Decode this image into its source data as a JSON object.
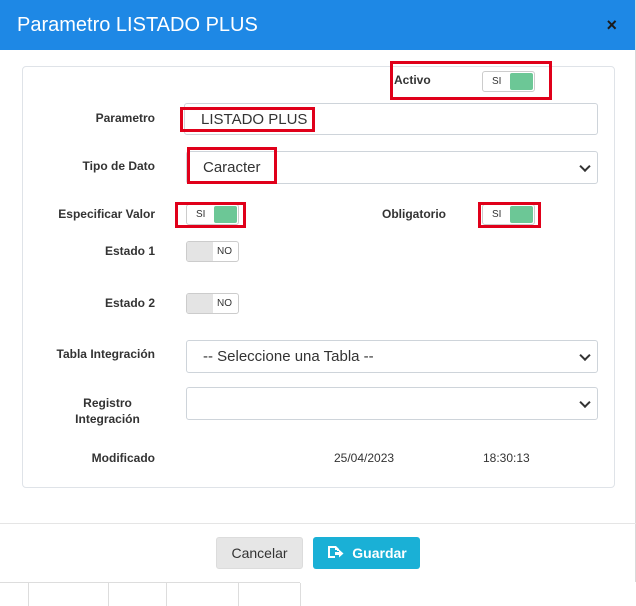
{
  "modal": {
    "title": "Parametro LISTADO PLUS",
    "close_glyph": "×"
  },
  "form": {
    "activo": {
      "label": "Activo",
      "state": "SI",
      "on": true
    },
    "parametro": {
      "label": "Parametro",
      "value": "LISTADO PLUS"
    },
    "tipo_dato": {
      "label": "Tipo de Dato",
      "value": "Caracter"
    },
    "especificar_valor": {
      "label": "Especificar Valor",
      "state": "SI",
      "on": true
    },
    "obligatorio": {
      "label": "Obligatorio",
      "state": "SI",
      "on": true
    },
    "estado1": {
      "label": "Estado 1",
      "state": "NO",
      "on": false
    },
    "estado2": {
      "label": "Estado 2",
      "state": "NO",
      "on": false
    },
    "tabla_integracion": {
      "label": "Tabla Integración",
      "value": "-- Seleccione una Tabla --"
    },
    "registro_integracion": {
      "label_line1": "Registro",
      "label_line2": "Integración",
      "value": ""
    },
    "modificado": {
      "label": "Modificado",
      "date": "25/04/2023",
      "time": "18:30:13"
    }
  },
  "footer": {
    "cancel_label": "Cancelar",
    "save_label": "Guardar"
  },
  "colors": {
    "header": "#1e88e5",
    "toggle_on": "#6cc796",
    "highlight": "#e0001a",
    "save_button": "#1ab0d6"
  },
  "icons": {
    "close": "close-icon",
    "save": "save-icon",
    "select_arrow": "chevron-down-icon"
  }
}
